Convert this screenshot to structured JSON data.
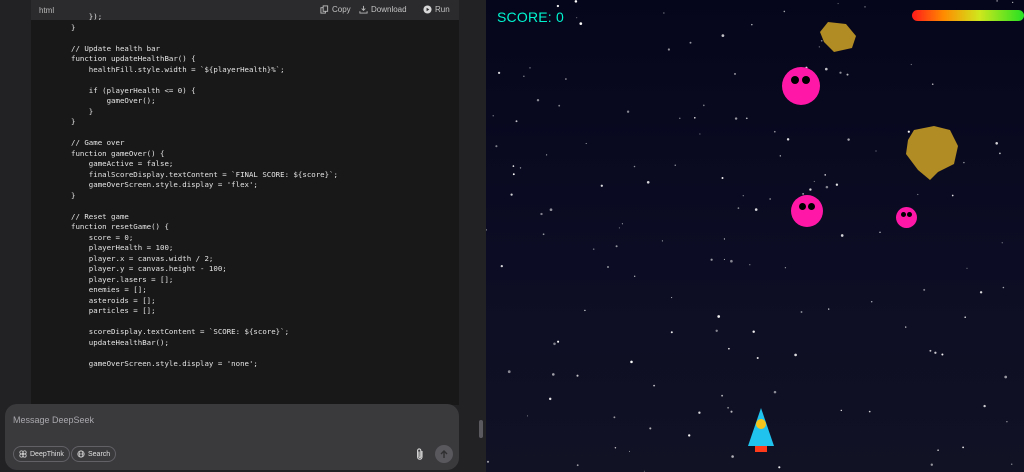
{
  "code_panel": {
    "language": "html",
    "copy_label": "Copy",
    "download_label": "Download",
    "run_label": "Run",
    "lines": [
      "    });",
      "}",
      "",
      "// Update health bar",
      "function updateHealthBar() {",
      "    healthFill.style.width = `${playerHealth}%`;",
      "",
      "    if (playerHealth <= 0) {",
      "        gameOver();",
      "    }",
      "}",
      "",
      "// Game over",
      "function gameOver() {",
      "    gameActive = false;",
      "    finalScoreDisplay.textContent = `FINAL SCORE: ${score}`;",
      "    gameOverScreen.style.display = 'flex';",
      "}",
      "",
      "// Reset game",
      "function resetGame() {",
      "    score = 0;",
      "    playerHealth = 100;",
      "    player.x = canvas.width / 2;",
      "    player.y = canvas.height - 100;",
      "    player.lasers = [];",
      "    enemies = [];",
      "    asteroids = [];",
      "    particles = [];",
      "",
      "    scoreDisplay.textContent = `SCORE: ${score}`;",
      "    updateHealthBar();",
      "",
      "    gameOverScreen.style.display = 'none';"
    ]
  },
  "composer": {
    "placeholder": "Message DeepSeek",
    "deepthink_label": "DeepThink",
    "search_label": "Search"
  },
  "game": {
    "score_text": "SCORE: 0",
    "health_percent": 100,
    "colors": {
      "score": "#00f5cf",
      "enemy": "#ff18a8",
      "asteroid": "#b18b23",
      "ship_body": "#1fc3ee",
      "ship_cockpit": "#f5c51b",
      "ship_thruster": "#ff3a1a"
    }
  }
}
